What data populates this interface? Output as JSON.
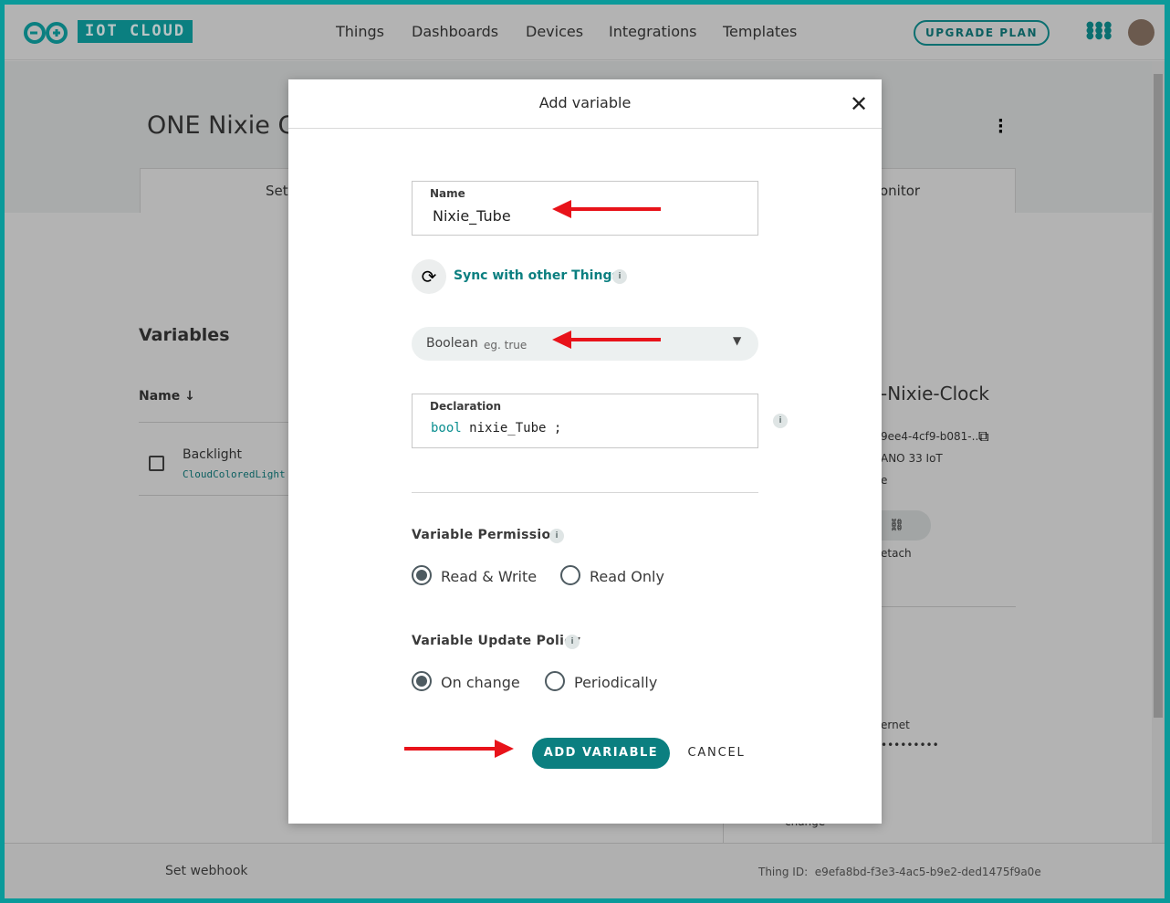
{
  "header": {
    "logo": "IOT CLOUD",
    "nav": [
      "Things",
      "Dashboards",
      "Devices",
      "Integrations",
      "Templates"
    ],
    "upgrade": "UPGRADE PLAN"
  },
  "page": {
    "title": "ONE Nixie C",
    "tab_left": "Set",
    "tab_right": "onitor",
    "variables_heading": "Variables",
    "name_col": "Name",
    "variable": {
      "name": "Backlight",
      "type": "CloudColoredLight"
    },
    "device": {
      "name": "-Nixie-Clock",
      "id": "9ee4-4cf9-b081-...",
      "board": "ANO 33 IoT",
      "status": "e",
      "detach": "etach",
      "network": "ernet",
      "password": "•••••••••",
      "change": "change"
    }
  },
  "footer": {
    "webhook": "Set webhook",
    "thing_id_label": "Thing ID:",
    "thing_id": "e9efa8bd-f3e3-4ac5-b9e2-ded1475f9a0e"
  },
  "modal": {
    "title": "Add variable",
    "name_label": "Name",
    "name_value": "Nixie_Tube",
    "sync": "Sync with other Things",
    "type": "Boolean",
    "type_hint": "eg. true",
    "declaration_label": "Declaration",
    "decl_type": "bool",
    "decl_name": "nixie_Tube",
    "decl_end": ";",
    "permission_label": "Variable Permission",
    "permission_options": [
      "Read & Write",
      "Read Only"
    ],
    "permission_selected": "Read & Write",
    "policy_label": "Variable Update Policy",
    "policy_options": [
      "On change",
      "Periodically"
    ],
    "policy_selected": "On change",
    "add": "ADD VARIABLE",
    "cancel": "CANCEL"
  },
  "colors": {
    "accent": "#0b7f80",
    "frame": "#0b9a9a",
    "arrow": "#e8131a"
  }
}
